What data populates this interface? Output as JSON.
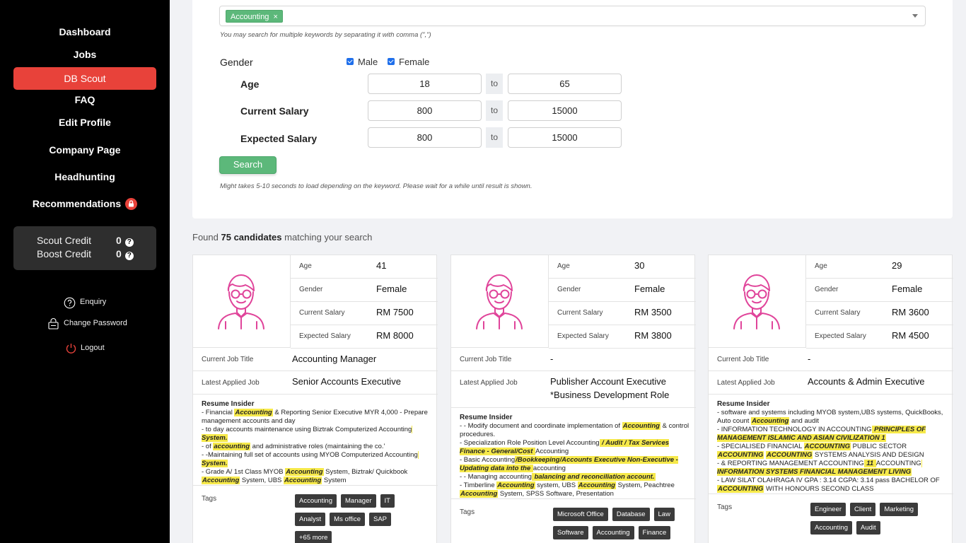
{
  "sidebar": {
    "nav": [
      "Dashboard",
      "Jobs",
      "DB Scout",
      "FAQ",
      "Edit Profile",
      "Company Page",
      "Headhunting",
      "Recommendations"
    ],
    "credits": {
      "scout_label": "Scout Credit",
      "scout_value": "0",
      "boost_label": "Boost Credit",
      "boost_value": "0"
    },
    "links": {
      "enquiry": "Enquiry",
      "change_password": "Change Password",
      "logout": "Logout"
    }
  },
  "search": {
    "keyword_chip": "Accounting",
    "keyword_hint": "You may search for multiple keywords by separating it with comma (\",\")",
    "gender_label": "Gender",
    "male": "Male",
    "female": "Female",
    "age_label": "Age",
    "age_from": "18",
    "age_to": "65",
    "cur_salary_label": "Current Salary",
    "cur_from": "800",
    "cur_to": "15000",
    "exp_salary_label": "Expected Salary",
    "exp_from": "800",
    "exp_to": "15000",
    "to": "to",
    "button": "Search",
    "load_hint": "Might takes 5-10 seconds to load depending on the keyword. Please wait for a while until result is shown."
  },
  "results": {
    "found_prefix": "Found",
    "found_count": "75 candidates",
    "found_suffix": "matching your search"
  },
  "labels": {
    "age": "Age",
    "gender": "Gender",
    "current_salary": "Current Salary",
    "expected_salary": "Expected Salary",
    "job_title": "Current Job Title",
    "applied_job": "Latest Applied Job",
    "resume": "Resume Insider",
    "tags": "Tags"
  },
  "candidates": [
    {
      "age": "41",
      "gender": "Female",
      "current_salary": "RM 7500",
      "expected_salary": "RM 8000",
      "job_title": "Accounting Manager",
      "applied_job": "Senior Accounts Executive",
      "tags": [
        "Accounting",
        "Manager",
        "IT",
        "Analyst",
        "Ms office",
        "SAP",
        "+65 more"
      ]
    },
    {
      "age": "30",
      "gender": "Female",
      "current_salary": "RM 3500",
      "expected_salary": "RM 3800",
      "job_title": "-",
      "applied_job": "Publisher Account Executive *Business Development Role",
      "tags": [
        "Microsoft Office",
        "Database",
        "Law",
        "Software",
        "Accounting",
        "Finance"
      ]
    },
    {
      "age": "29",
      "gender": "Female",
      "current_salary": "RM 3600",
      "expected_salary": "RM 4500",
      "job_title": "-",
      "applied_job": "Accounts & Admin Executive",
      "tags": [
        "Engineer",
        "Client",
        "Marketing",
        "Accounting",
        "Audit"
      ]
    }
  ],
  "resumes": {
    "c0": [
      "- Financial ",
      "Accounting",
      " & Reporting Senior Executive MYR 4,000 - Prepare management accounts and day",
      "- to day accounts maintenance using Biztrak Computerized ",
      "Accounting",
      " System.",
      "- of ",
      "accounting",
      " and administrative roles (maintaining the co.'",
      "- -Maintaining full set of accounts using MYOB Computerized ",
      "Accounting",
      " System.",
      "- Grade A/ 1st Class MYOB ",
      "Accounting",
      " System, Biztrak/ Quickbook ",
      "Accounting",
      " System, UBS ",
      "Accounting",
      " System"
    ],
    "c1": [
      "- - Modify document and coordinate implementation of ",
      "Accounting",
      " & control procedures.",
      "- Specialization Role Position Level ",
      "Accounting",
      " / Audit / Tax Services Finance - General/Cost ",
      "Accounting",
      "- Basic ",
      "Accounting",
      "/Bookkeeping/Accounts Executive Non-Executive - Updating data into the ",
      "accounting",
      "- - Managing ",
      "accounting",
      " balancing and reconciliation account.",
      "- Timberline ",
      "Accounting",
      " system, UBS ",
      "Accounting",
      " System, Peachtree ",
      "Accounting",
      " System, SPSS Software, Presentation"
    ],
    "c2": [
      "- software and systems including MYOB system,UBS systems, QuickBooks, Auto count ",
      "Accounting",
      " and audit",
      "- INFORMATION TECHNOLOGY IN ",
      "ACCOUNTING",
      " PRINCIPLES OF MANAGEMENT ISLAMIC AND ASIAN CIVILIZATION 1",
      "- SPECIALISED FINANCIAL ",
      "ACCOUNTING",
      " PUBLIC SECTOR ",
      "ACCOUNTING",
      " ",
      "ACCOUNTING",
      " SYSTEMS ANALYSIS AND DESIGN",
      "- & REPORTING MANAGEMENT ",
      "ACCOUNTING",
      " 11 ",
      "ACCOUNTING",
      " INFORMATION SYSTEMS FINANCIAL MANAGEMENT LIVING",
      "- LAW SILAT OLAHRAGA IV GPA : 3.14 CGPA: 3.14 pass BACHELOR OF ",
      "ACCOUNTING",
      " WITH HONOURS SECOND CLASS"
    ]
  }
}
